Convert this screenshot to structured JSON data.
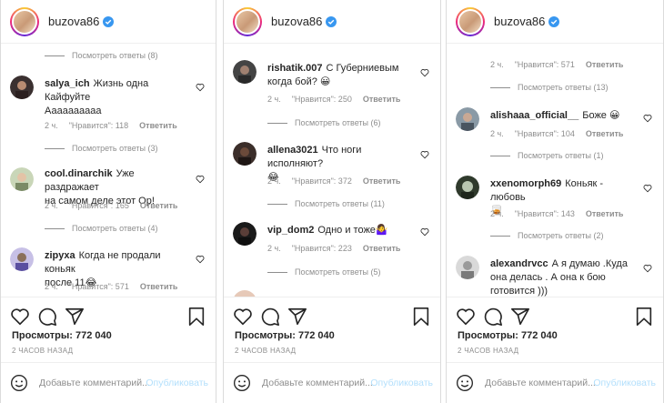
{
  "colors": {
    "text": "#262626",
    "muted": "#8e8e8e",
    "link": "#b2dffc",
    "verified": "#3897f0"
  },
  "panels": [
    {
      "header": {
        "username": "buzova86",
        "avatar_icon": "profile-avatar-icon",
        "verified_icon": "verified-badge-icon"
      },
      "top_view_replies": "Посмотреть ответы (8)",
      "comments": [
        {
          "user": "salya_ich",
          "text": "Жизнь одна Кайфуйте Аааааааааа",
          "lines": [
            "Жизнь одна",
            "Кайфуйте",
            "Аааааааааа"
          ],
          "time": "2 ч.",
          "likes": "\"Нравится\": 118",
          "reply": "Ответить",
          "view_replies": "Посмотреть ответы (3)"
        },
        {
          "user": "cool.dinarchik",
          "text": "Уже раздражает на самом деле этот Ор!",
          "lines": [
            "Уже раздражает",
            "на самом деле этот Ор!"
          ],
          "time": "2 ч.",
          "likes": "\"Нравится\": 165",
          "reply": "Ответить",
          "view_replies": "Посмотреть ответы (4)"
        },
        {
          "user": "zipyxa",
          "text": "Когда не продали коньяк после 11😂",
          "lines": [
            "Когда не продали коньяк",
            "после 11😂"
          ],
          "time": "2 ч.",
          "likes": "\"Нравится\": 571",
          "reply": "Ответить",
          "view_replies": ""
        }
      ],
      "views": "Просмотры: 772 040",
      "time_ago": "2 ЧАСОВ НАЗАД",
      "add_comment_placeholder": "Добавьте комментарий...",
      "publish": "Опубликовать"
    },
    {
      "header": {
        "username": "buzova86",
        "avatar_icon": "profile-avatar-icon",
        "verified_icon": "verified-badge-icon"
      },
      "top_view_replies": "",
      "comments": [
        {
          "user": "rishatik.007",
          "text": "С Губерниевым когда бой? 😀",
          "lines": [
            "С Губерниевым",
            "когда бой? 😀"
          ],
          "time": "2 ч.",
          "likes": "\"Нравится\": 250",
          "reply": "Ответить",
          "view_replies": "Посмотреть ответы (6)"
        },
        {
          "user": "allena3021",
          "text": "Что ноги исполняют? 😂",
          "lines": [
            "Что ноги исполняют?",
            "😂"
          ],
          "time": "2 ч.",
          "likes": "\"Нравится\": 372",
          "reply": "Ответить",
          "view_replies": "Посмотреть ответы (11)"
        },
        {
          "user": "vip_dom2",
          "text": "Одно и тоже🤷‍♀️",
          "lines": [
            "Одно и тоже🤷‍♀️"
          ],
          "time": "2 ч.",
          "likes": "\"Нравится\": 223",
          "reply": "Ответить",
          "view_replies": "Посмотреть ответы (5)"
        }
      ],
      "views": "Просмотры: 772 040",
      "time_ago": "2 ЧАСОВ НАЗАД",
      "add_comment_placeholder": "Добавьте комментарий...",
      "publish": "Опубликовать"
    },
    {
      "header": {
        "username": "buzova86",
        "avatar_icon": "profile-avatar-icon",
        "verified_icon": "verified-badge-icon"
      },
      "top_view_replies": "",
      "top_meta": {
        "time": "2 ч.",
        "likes": "\"Нравится\": 571",
        "reply": "Ответить",
        "view_replies": "Посмотреть ответы (13)"
      },
      "comments": [
        {
          "user": "alishaaa_official__",
          "text": "Боже 😀",
          "lines": [
            "Боже 😀"
          ],
          "time": "2 ч.",
          "likes": "\"Нравится\": 104",
          "reply": "Ответить",
          "view_replies": "Посмотреть ответы (1)"
        },
        {
          "user": "xxenomorph69",
          "text": "Коньяк - любовь 🥃",
          "lines": [
            "Коньяк - любовь",
            "🥃"
          ],
          "time": "2 ч.",
          "likes": "\"Нравится\": 143",
          "reply": "Ответить",
          "view_replies": "Посмотреть ответы (2)"
        },
        {
          "user": "alexandrvcc",
          "text": "А я думаю .Куда она делась . А она к бою готовится )))",
          "lines": [
            "А я думаю .Куда",
            "она делась . А она к бою",
            "готовится )))"
          ],
          "time": "",
          "likes": "",
          "reply": "",
          "view_replies": ""
        }
      ],
      "views": "Просмотры: 772 040",
      "time_ago": "2 ЧАСОВ НАЗАД",
      "add_comment_placeholder": "Добавьте комментарий...",
      "publish": "Опубликовать"
    }
  ],
  "icons": [
    "heart-icon",
    "comment-icon",
    "share-icon",
    "bookmark-icon",
    "emoji-icon",
    "like-small-icon"
  ]
}
